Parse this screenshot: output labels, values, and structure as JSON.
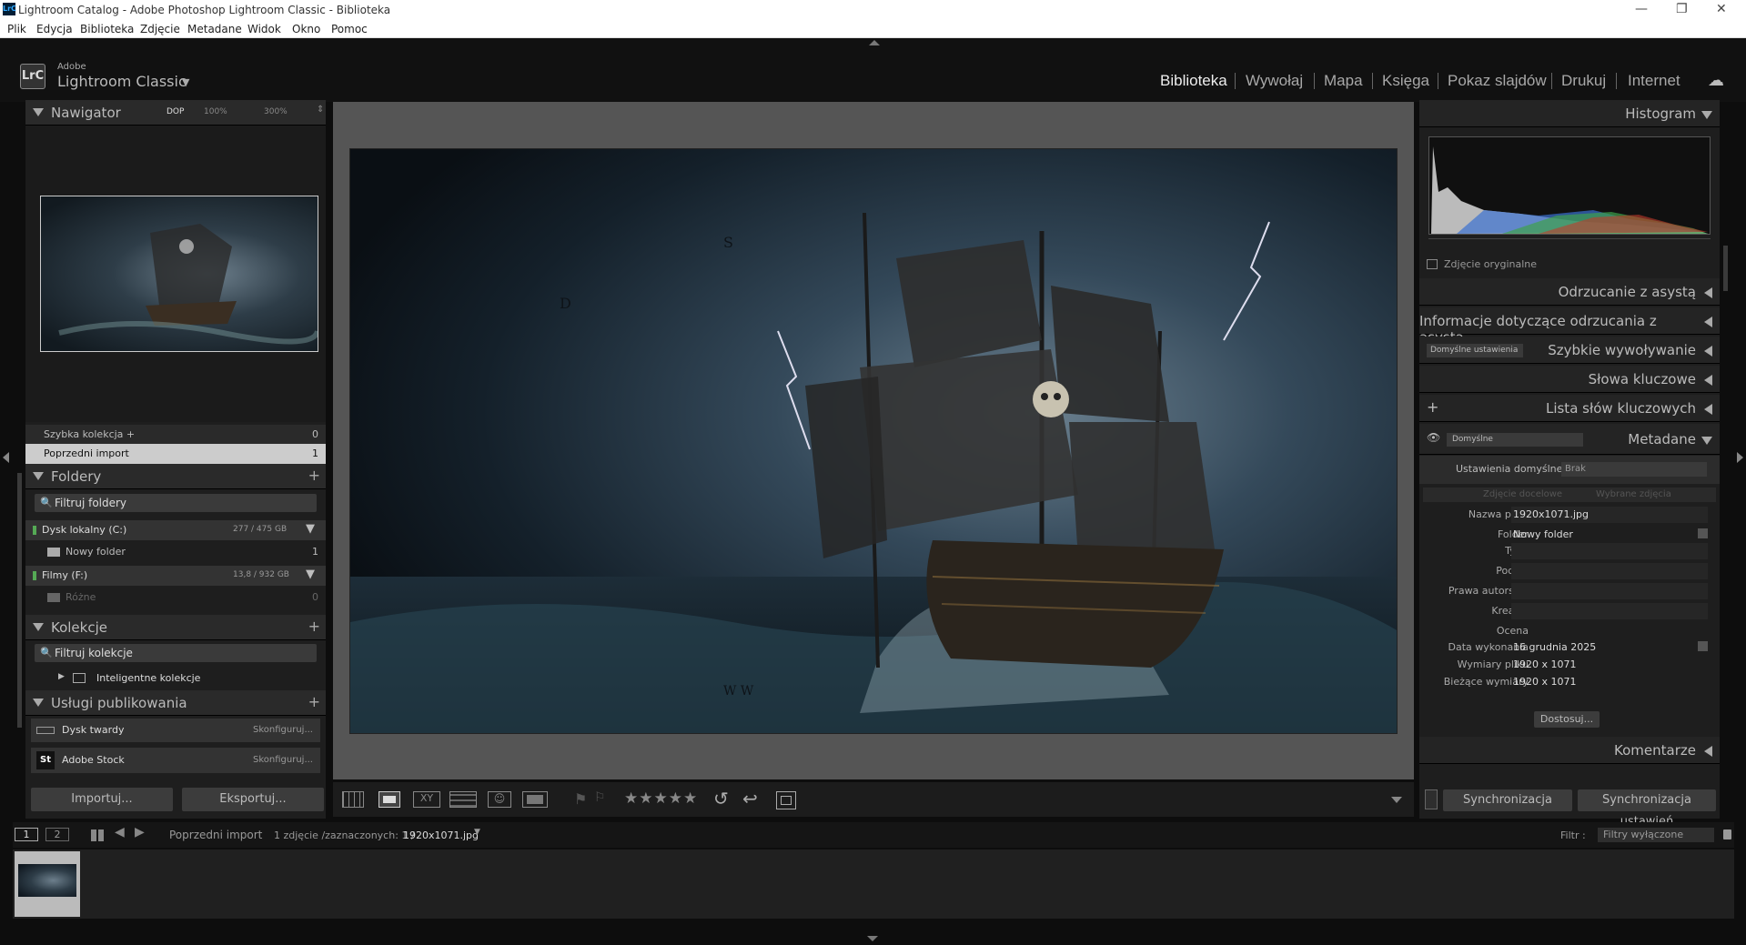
{
  "window": {
    "title": "Lightroom Catalog - Adobe Photoshop Lightroom Classic - Biblioteka"
  },
  "menu": [
    "Plik",
    "Edycja",
    "Biblioteka",
    "Zdjęcie",
    "Metadane",
    "Widok",
    "Okno",
    "Pomoc"
  ],
  "identity": {
    "brand_small": "Adobe",
    "brand": "Lightroom Classic"
  },
  "modules": [
    "Biblioteka",
    "Wywołaj",
    "Mapa",
    "Księga",
    "Pokaz slajdów",
    "Drukuj",
    "Internet"
  ],
  "navigator": {
    "title": "Nawigator",
    "zoom": [
      "DOP",
      "100%",
      "300%"
    ]
  },
  "catalog": [
    {
      "label": "Szybka kolekcja +",
      "count": "0"
    },
    {
      "label": "Poprzedni import",
      "count": "1"
    }
  ],
  "folders": {
    "title": "Foldery",
    "filter": "Filtruj foldery",
    "volumes": [
      {
        "name": "Dysk lokalny (C:)",
        "size": "277 / 475 GB"
      },
      {
        "name": "Filmy (F:)",
        "size": "13,8 / 932 GB"
      }
    ],
    "items": [
      {
        "name": "Nowy folder",
        "count": "1"
      },
      {
        "name": "Różne",
        "count": "0"
      }
    ]
  },
  "collections": {
    "title": "Kolekcje",
    "filter": "Filtruj kolekcje",
    "smart": "Inteligentne kolekcje"
  },
  "publish": {
    "title": "Usługi publikowania",
    "services": [
      {
        "name": "Dysk twardy",
        "action": "Skonfiguruj..."
      },
      {
        "name": "Adobe Stock",
        "action": "Skonfiguruj..."
      }
    ]
  },
  "buttons": {
    "import": "Importuj...",
    "export": "Eksportuj...",
    "sync": "Synchronizacja",
    "sync_settings": "Synchronizacja ustawień",
    "customize": "Dostosuj..."
  },
  "right": {
    "histogram": "Histogram",
    "original": "Zdjęcie oryginalne",
    "panels": [
      "Odrzucanie z asystą",
      "Informacje dotyczące odrzucania z asystą",
      "Szybkie wywoływanie",
      "Słowa kluczowe",
      "Lista słów kluczowych",
      "Metadane",
      "Komentarze"
    ],
    "quick_preset": "Domyślne ustawienia",
    "meta_preset": "Domyślne",
    "defaults_label": "Ustawienia domyślne",
    "defaults_value": "Brak",
    "target_tabs": [
      "Zdjęcie docelowe",
      "Wybrane zdjęcia"
    ],
    "fields": [
      {
        "k": "Nazwa pliku",
        "v": "1920x1071.jpg"
      },
      {
        "k": "Folder",
        "v": "Nowy folder"
      },
      {
        "k": "Tytuł",
        "v": ""
      },
      {
        "k": "Podpis",
        "v": ""
      },
      {
        "k": "Prawa autorskie",
        "v": ""
      },
      {
        "k": "Kreator",
        "v": ""
      },
      {
        "k": "Ocena",
        "v": ""
      },
      {
        "k": "Data wykonania",
        "v": "16 grudnia 2025"
      },
      {
        "k": "Wymiary pliku",
        "v": "1920 x 1071"
      },
      {
        "k": "Bieżące wymiary",
        "v": "1920 x 1071"
      }
    ]
  },
  "toolbar": {
    "stars": "★★★★★"
  },
  "filmbar": {
    "screens": [
      "1",
      "2"
    ],
    "source": "Poprzedni import",
    "status": "1 zdjęcie /zaznaczonych: 1 /",
    "file": "1920x1071.jpg",
    "filter_label": "Filtr :",
    "filter_value": "Filtry wyłączone"
  }
}
